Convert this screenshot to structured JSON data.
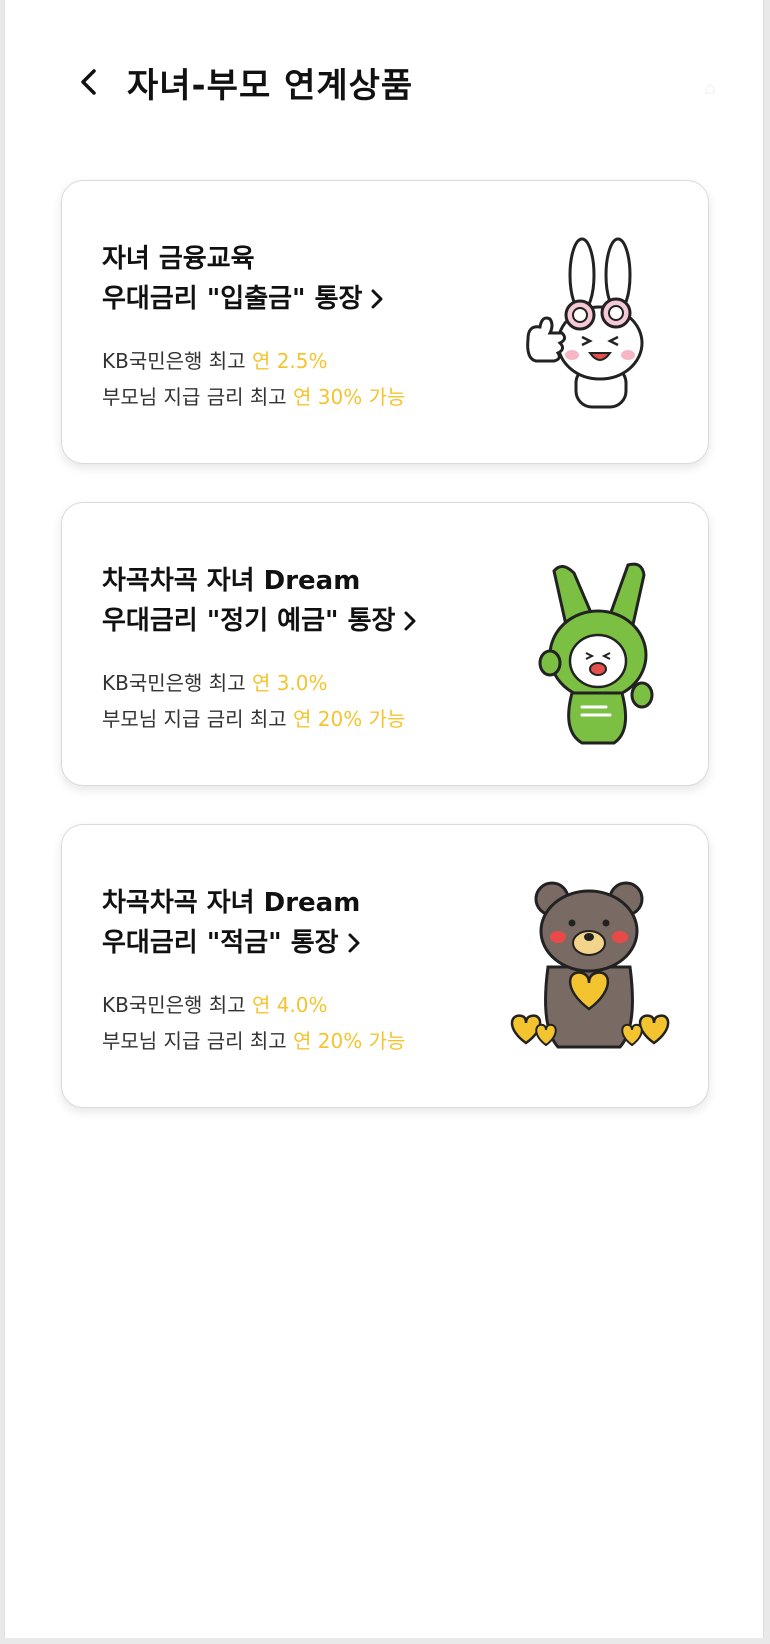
{
  "header": {
    "title": "자녀-부모 연계상품",
    "back_icon": "chevron-left-icon"
  },
  "colors": {
    "accent": "#f4c430",
    "text": "#111111",
    "card_border": "#dadada"
  },
  "products": [
    {
      "title_line1": "자녀 금융교육",
      "title_line2": "우대금리 \"입출금\" 통장",
      "bank_label": "KB국민은행 최고",
      "bank_rate": "연 2.5%",
      "parent_label": "부모님 지급 금리 최고",
      "parent_rate": "연 30% 가능",
      "icon": "rabbit-character-icon"
    },
    {
      "title_line1": "차곡차곡 자녀 Dream",
      "title_line2": "우대금리 \"정기 예금\" 통장",
      "bank_label": "KB국민은행 최고",
      "bank_rate": "연 3.0%",
      "parent_label": "부모님 지급 금리 최고",
      "parent_rate": "연 20% 가능",
      "icon": "green-character-icon"
    },
    {
      "title_line1": "차곡차곡 자녀 Dream",
      "title_line2": "우대금리 \"적금\" 통장",
      "bank_label": "KB국민은행 최고",
      "bank_rate": "연 4.0%",
      "parent_label": "부모님 지급 금리 최고",
      "parent_rate": "연 20% 가능",
      "icon": "bear-character-icon"
    }
  ]
}
